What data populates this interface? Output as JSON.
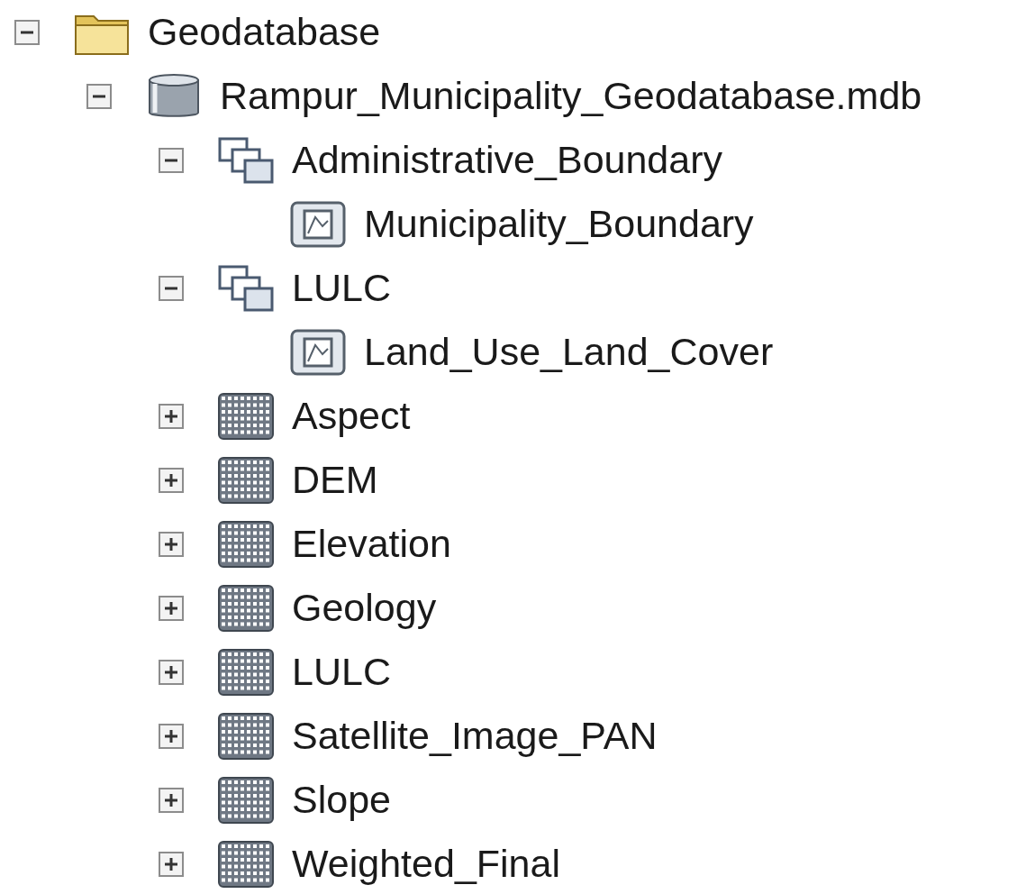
{
  "tree": [
    {
      "label": "Geodatabase",
      "kind": "folder",
      "expanded": true,
      "children": [
        {
          "label": "Rampur_Municipality_Geodatabase.mdb",
          "kind": "database",
          "expanded": true,
          "children": [
            {
              "label": "Administrative_Boundary",
              "kind": "dataset",
              "expanded": true,
              "children": [
                {
                  "label": "Municipality_Boundary",
                  "kind": "featureclass"
                }
              ]
            },
            {
              "label": "LULC",
              "kind": "dataset",
              "expanded": true,
              "children": [
                {
                  "label": "Land_Use_Land_Cover",
                  "kind": "featureclass"
                }
              ]
            },
            {
              "label": "Aspect",
              "kind": "raster",
              "expanded": false
            },
            {
              "label": "DEM",
              "kind": "raster",
              "expanded": false
            },
            {
              "label": "Elevation",
              "kind": "raster",
              "expanded": false
            },
            {
              "label": "Geology",
              "kind": "raster",
              "expanded": false
            },
            {
              "label": "LULC",
              "kind": "raster",
              "expanded": false
            },
            {
              "label": "Satellite_Image_PAN",
              "kind": "raster",
              "expanded": false
            },
            {
              "label": "Slope",
              "kind": "raster",
              "expanded": false
            },
            {
              "label": "Weighted_Final",
              "kind": "raster",
              "expanded": false
            }
          ]
        }
      ]
    }
  ]
}
